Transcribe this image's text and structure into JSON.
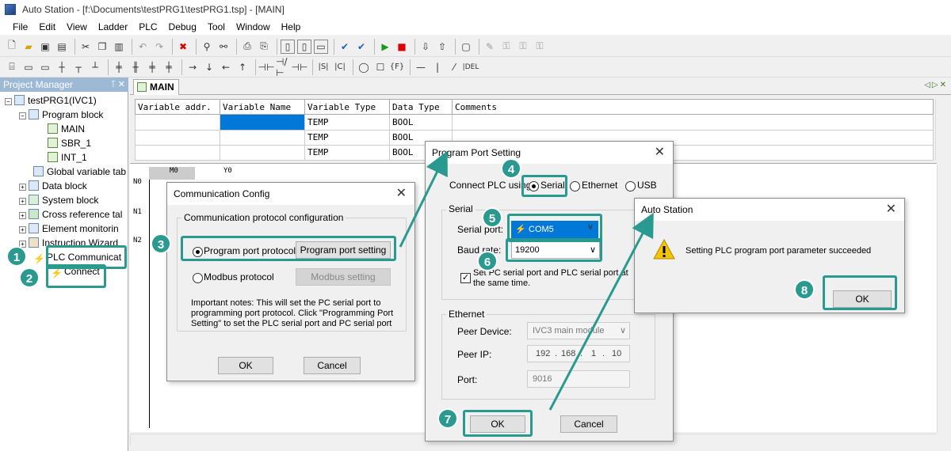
{
  "window": {
    "title": "Auto Station - [f:\\Documents\\testPRG1\\testPRG1.tsp] - [MAIN]"
  },
  "menu": [
    "File",
    "Edit",
    "View",
    "Ladder",
    "PLC",
    "Debug",
    "Tool",
    "Window",
    "Help"
  ],
  "project_manager": {
    "title": "Project Manager",
    "tree": {
      "root": "testPRG1(IVC1)",
      "program_block": "Program block",
      "main": "MAIN",
      "sbr": "SBR_1",
      "int": "INT_1",
      "global_var": "Global variable tab",
      "data_block": "Data block",
      "system_block": "System block",
      "cross_ref": "Cross reference tal",
      "element_mon": "Element monitorin",
      "instr_wizard": "Instruction Wizard",
      "plc_comm": "PLC Communicat",
      "connect": "Connect"
    }
  },
  "editor": {
    "tab": "MAIN",
    "columns": [
      "Variable addr.",
      "Variable Name",
      "Variable Type",
      "Data Type",
      "Comments"
    ],
    "rows": [
      [
        "",
        "",
        "TEMP",
        "BOOL",
        ""
      ],
      [
        "",
        "",
        "TEMP",
        "BOOL",
        ""
      ],
      [
        "",
        "",
        "TEMP",
        "BOOL",
        ""
      ]
    ],
    "ladder": {
      "contact": "M0",
      "coil": "Y0",
      "networks": [
        "N0",
        "N1",
        "N2"
      ]
    }
  },
  "comm_config": {
    "title": "Communication Config",
    "group": "Communication protocol configuration",
    "program_port": "Program port protocol",
    "program_port_btn": "Program port setting",
    "modbus": "Modbus protocol",
    "modbus_btn": "Modbus setting",
    "notes": "Important notes: This will set the PC serial port to programming port protocol. Click \"Programming Port Setting\" to set the PLC serial port and PC serial port",
    "ok": "OK",
    "cancel": "Cancel"
  },
  "port_setting": {
    "title": "Program Port Setting",
    "connect_using": "Connect PLC using:",
    "serial": "Serial",
    "ethernet": "Ethernet",
    "usb": "USB",
    "serial_group": "Serial",
    "serial_port_label": "Serial port:",
    "serial_port_value": "COM5",
    "baud_label": "Baud rate:",
    "baud_value": "19200",
    "sync_text": "Set PC serial port and PLC serial port at the same time.",
    "eth_group": "Ethernet",
    "peer_device_label": "Peer Device:",
    "peer_device_value": "IVC3 main module",
    "peer_ip_label": "Peer IP:",
    "ip": [
      "192",
      "168",
      "1",
      "10"
    ],
    "port_label": "Port:",
    "port_value": "9016",
    "ok": "OK",
    "cancel": "Cancel"
  },
  "success": {
    "title": "Auto Station",
    "message": "Setting PLC program port parameter succeeded",
    "ok": "OK"
  },
  "badges": [
    "1",
    "2",
    "3",
    "4",
    "5",
    "6",
    "7",
    "8"
  ],
  "colors": {
    "accent": "#2a9a90",
    "selection": "#0078d7",
    "pm_header": "#9db9d6"
  }
}
